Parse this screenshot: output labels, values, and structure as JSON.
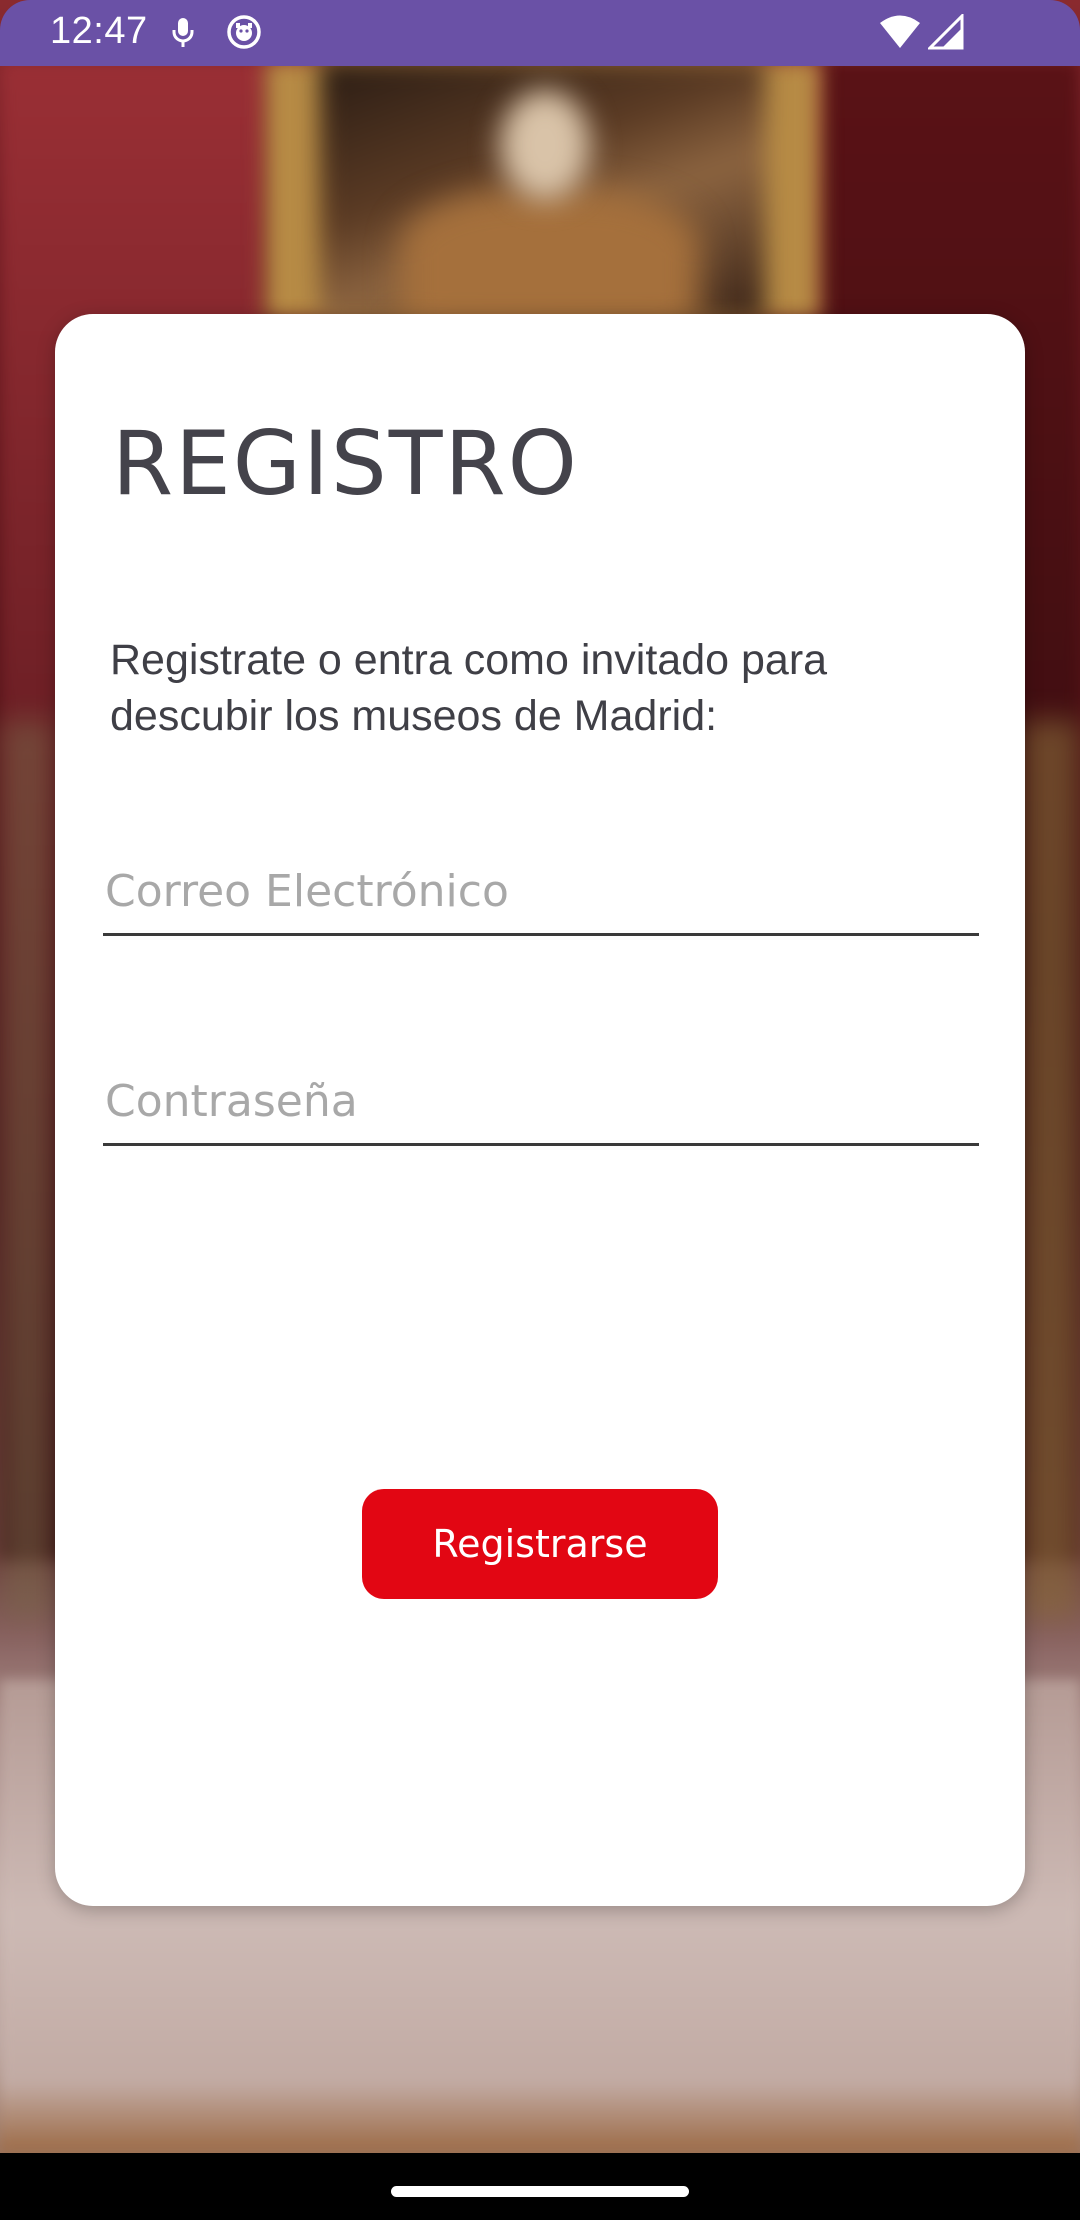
{
  "status_bar": {
    "time": "12:47",
    "icons": [
      "mic-icon",
      "bug-icon",
      "wifi-icon",
      "signal-icon"
    ],
    "background_color": "#6a51a6"
  },
  "register": {
    "title": "REGISTRO",
    "subtitle": "Registrate o entra como invitado para descubir los museos de Madrid:",
    "email_placeholder": "Correo Electrónico",
    "email_value": "",
    "password_placeholder": "Contraseña",
    "password_value": "",
    "button_label": "Registrarse",
    "button_color": "#e20613"
  },
  "background": {
    "description_icon": "museum-background"
  }
}
